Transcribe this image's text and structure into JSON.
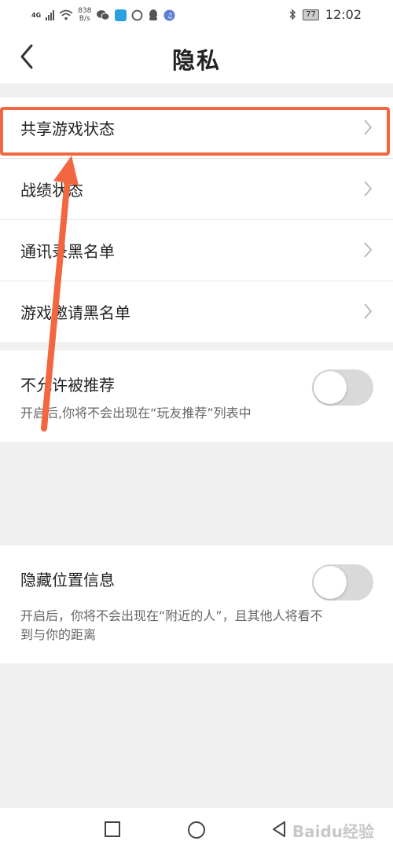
{
  "status_bar": {
    "network": "4G",
    "net_speed_value": "838",
    "net_speed_unit": "B/s",
    "battery": "77",
    "time": "12:02"
  },
  "header": {
    "title": "隐私"
  },
  "menu_rows": [
    {
      "label": "共享游戏状态"
    },
    {
      "label": "战绩状态"
    },
    {
      "label": "通讯录黑名单"
    },
    {
      "label": "游戏邀请黑名单"
    }
  ],
  "toggles": [
    {
      "title": "不允许被推荐",
      "desc": "开启后,你将不会出现在“玩友推荐”列表中",
      "on": false
    },
    {
      "title": "隐藏位置信息",
      "desc": "开启后，你将不会出现在“附近的人”，且其他人将看不到与你的距离",
      "on": false
    }
  ],
  "annotation": {
    "color": "#f2673f"
  },
  "watermark": "Baidu经验"
}
